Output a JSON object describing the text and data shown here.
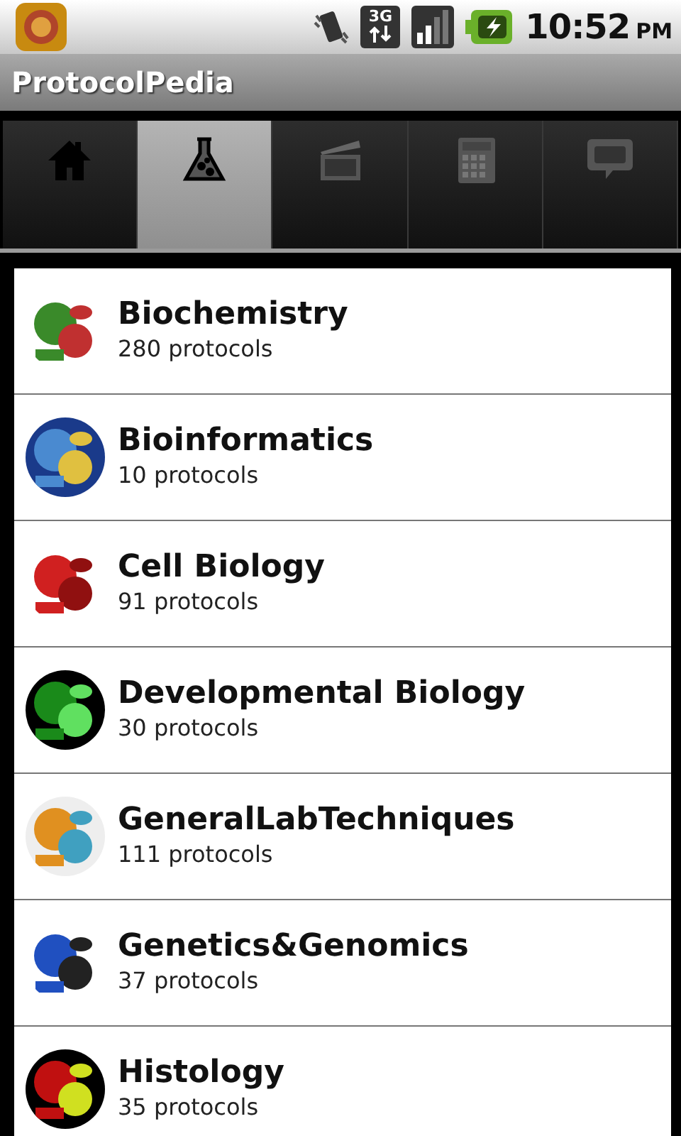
{
  "status_bar": {
    "network": "3G",
    "time": "10:52",
    "meridiem": "PM"
  },
  "title_bar": {
    "title": "ProtocolPedia"
  },
  "tabs": [
    {
      "kind": "home",
      "selected": false
    },
    {
      "kind": "flask",
      "selected": true
    },
    {
      "kind": "clapper",
      "selected": false
    },
    {
      "kind": "calculator",
      "selected": false
    },
    {
      "kind": "speech",
      "selected": false
    }
  ],
  "categories": [
    {
      "name": "Biochemistry",
      "count": "280 protocols"
    },
    {
      "name": "Bioinformatics",
      "count": "10 protocols"
    },
    {
      "name": "Cell Biology",
      "count": "91 protocols"
    },
    {
      "name": "Developmental Biology",
      "count": "30 protocols"
    },
    {
      "name": "GeneralLabTechniques",
      "count": "111 protocols"
    },
    {
      "name": "Genetics&Genomics",
      "count": "37 protocols"
    },
    {
      "name": "Histology",
      "count": "35 protocols"
    }
  ]
}
